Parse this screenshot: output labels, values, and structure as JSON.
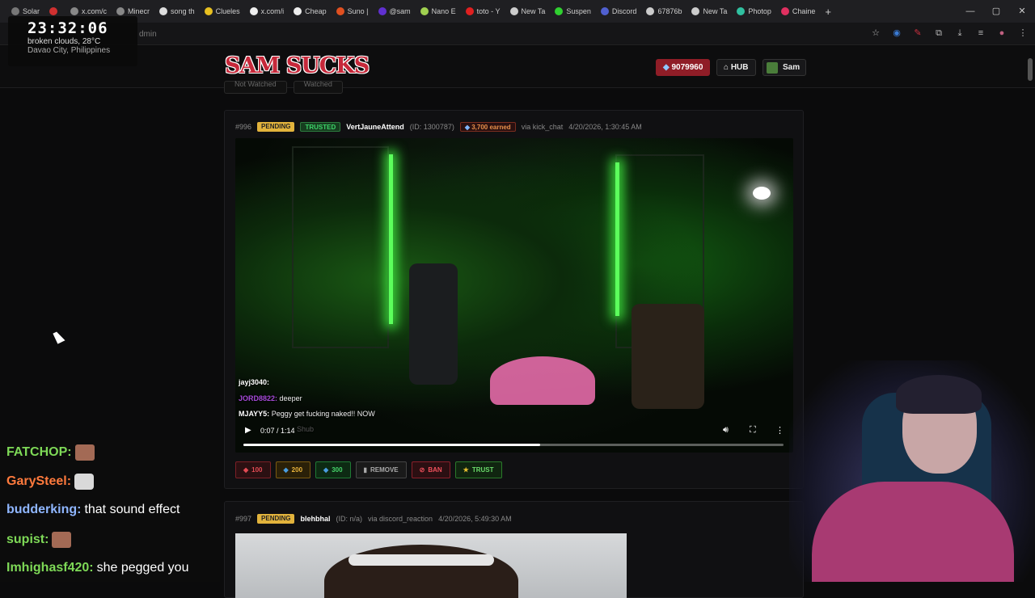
{
  "browser": {
    "tabs": [
      {
        "label": "Solar",
        "color": "#777"
      },
      {
        "label": "",
        "color": "#d03030"
      },
      {
        "label": "x.com/c",
        "color": "#888"
      },
      {
        "label": "Minecr",
        "color": "#888"
      },
      {
        "label": "song th",
        "color": "#ddd"
      },
      {
        "label": "Clueles",
        "color": "#e8c020"
      },
      {
        "label": "x.com/i",
        "color": "#eee"
      },
      {
        "label": "Cheap",
        "color": "#eee"
      },
      {
        "label": "Suno |",
        "color": "#e05020"
      },
      {
        "label": "@sam",
        "color": "#6030d0"
      },
      {
        "label": "Nano E",
        "color": "#a0d050"
      },
      {
        "label": "toto - Y",
        "color": "#e02020"
      },
      {
        "label": "New Ta",
        "color": "#ccc"
      },
      {
        "label": "Suspen",
        "color": "#30d030"
      },
      {
        "label": "Discord",
        "color": "#5060d0"
      },
      {
        "label": "67876b",
        "color": "#ccc"
      },
      {
        "label": "New Ta",
        "color": "#ccc"
      },
      {
        "label": "Photop",
        "color": "#30c0a0"
      },
      {
        "label": "Chaine",
        "color": "#e03060"
      }
    ],
    "new_tab": "+",
    "url": "dmin",
    "window_controls": [
      "—",
      "▢",
      "✕"
    ]
  },
  "clock": {
    "time": "23:32:06",
    "weather": "broken clouds, 28°C",
    "location": "Davao City, Philippines"
  },
  "site": {
    "logo": "SAM SUCKS",
    "balance": "9079960",
    "hub": "HUB",
    "user": "Sam",
    "filters": [
      "Not Watched",
      "Watched"
    ]
  },
  "submissions": [
    {
      "id": "#996",
      "status": "PENDING",
      "trust": "TRUSTED",
      "username": "VertJauneAttend",
      "user_id": "(ID: 1300787)",
      "earned": "3,700 earned",
      "source": "via kick_chat",
      "date": "4/20/2026, 1:30:45 AM",
      "video": {
        "time": "0:07 / 1:14",
        "progress": 0.55,
        "overlay_chat": [
          {
            "name": "jayj3040:",
            "text": ""
          },
          {
            "name": "JORD8822:",
            "text": "deeper"
          },
          {
            "name": "MJAYY5:",
            "text": "Peggy get fucking naked!! NOW"
          }
        ],
        "overlay_faint": "Shub"
      },
      "actions": {
        "a100": "100",
        "a200": "200",
        "a300": "300",
        "remove": "REMOVE",
        "ban": "BAN",
        "trust": "TRUST"
      }
    },
    {
      "id": "#997",
      "status": "PENDING",
      "username": "blehbhal",
      "user_id": "(ID: n/a)",
      "source": "via discord_reaction",
      "date": "4/20/2026, 5:49:30 AM"
    }
  ],
  "stream_chat": [
    {
      "name": "FATCHOP:",
      "color": "#7ed957",
      "text": "",
      "emote": "face"
    },
    {
      "name": "GarySteel:",
      "color": "#ff7a3d",
      "text": "",
      "emote": "cat"
    },
    {
      "name": "budderking:",
      "color": "#8fb6ff",
      "text": "that sound effect",
      "emote": ""
    },
    {
      "name": "supist:",
      "color": "#7ed957",
      "text": "",
      "emote": "face"
    },
    {
      "name": "Imhighasf420:",
      "color": "#7ed957",
      "text": "she pegged you",
      "emote": ""
    }
  ]
}
